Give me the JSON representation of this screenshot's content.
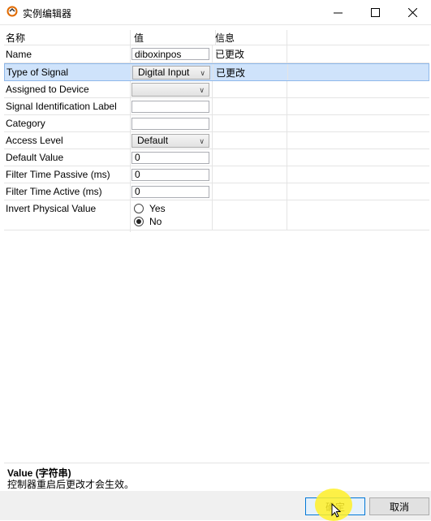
{
  "window": {
    "title": "实例编辑器",
    "icons": {
      "app": "app-editor-icon",
      "minimize": "minimize-icon",
      "maximize": "maximize-icon",
      "close": "close-icon"
    }
  },
  "table": {
    "headers": [
      "名称",
      "值",
      "信息"
    ],
    "rows": [
      {
        "name": "Name",
        "control": "text",
        "value": "diboxinpos",
        "info": "已更改"
      },
      {
        "name": "Type of Signal",
        "control": "combo",
        "value": "Digital Input",
        "info": "已更改",
        "selected": true
      },
      {
        "name": "Assigned to Device",
        "control": "combo",
        "value": "",
        "info": ""
      },
      {
        "name": "Signal Identification Label",
        "control": "text",
        "value": "",
        "info": ""
      },
      {
        "name": "Category",
        "control": "text",
        "value": "",
        "info": ""
      },
      {
        "name": "Access Level",
        "control": "combo",
        "value": "Default",
        "info": ""
      },
      {
        "name": "Default Value",
        "control": "text",
        "value": "0",
        "info": ""
      },
      {
        "name": "Filter Time Passive (ms)",
        "control": "text",
        "value": "0",
        "info": ""
      },
      {
        "name": "Filter Time Active (ms)",
        "control": "text",
        "value": "0",
        "info": ""
      },
      {
        "name": "Invert Physical Value",
        "control": "radio",
        "options": [
          "Yes",
          "No"
        ],
        "selected_option": "No",
        "info": ""
      }
    ]
  },
  "help": {
    "title": "Value (字符串)",
    "description": "控制器重启后更改才会生效。"
  },
  "buttons": {
    "ok": "确定",
    "cancel": "取消"
  },
  "colors": {
    "selected_row": "#cfe3fb",
    "accent": "#0078d7",
    "click_highlight": "#fff028"
  }
}
